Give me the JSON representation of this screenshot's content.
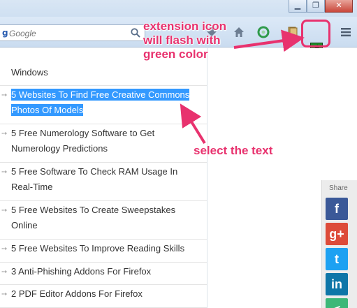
{
  "window": {
    "minimize_glyph": "▁",
    "restore_glyph": "❐",
    "close_glyph": "✕"
  },
  "toolbar": {
    "search_placeholder": "Google",
    "search_engine_icon": "google-icon",
    "icons": [
      "download-icon",
      "home-icon",
      "addon-icon",
      "bookmark-icon",
      "extension-icon",
      "menu-icon"
    ]
  },
  "articles": [
    {
      "title": "Windows",
      "lines": [
        "Windows"
      ],
      "selected": false
    },
    {
      "title": "5 Websites To Find Free Creative Commons Photos Of Models",
      "lines": [
        "5 Websites To Find Free Creative Commons",
        "Photos Of Models"
      ],
      "selected": true
    },
    {
      "title": "5 Free Numerology Software to Get Numerology Predictions",
      "lines": [
        "5 Free Numerology Software to Get",
        "Numerology Predictions"
      ],
      "selected": false
    },
    {
      "title": "5 Free Software To Check RAM Usage In Real-Time",
      "lines": [
        "5 Free Software To Check RAM Usage In",
        "Real-Time"
      ],
      "selected": false
    },
    {
      "title": "5 Free Websites To Create Sweepstakes Online",
      "lines": [
        "5 Free Websites To Create Sweepstakes",
        "Online"
      ],
      "selected": false
    },
    {
      "title": "5 Free Websites To Improve Reading Skills",
      "lines": [
        "5 Free Websites To Improve Reading Skills"
      ],
      "selected": false
    },
    {
      "title": "3 Anti-Phishing Addons For Firefox",
      "lines": [
        "3 Anti-Phishing Addons For Firefox"
      ],
      "selected": false
    },
    {
      "title": "2 PDF Editor Addons For Firefox",
      "lines": [
        "2 PDF Editor Addons For Firefox"
      ],
      "selected": false
    }
  ],
  "share": {
    "label": "Share",
    "buttons": [
      {
        "name": "facebook",
        "glyph": "f",
        "color": "#3b5998"
      },
      {
        "name": "google-plus",
        "glyph": "g+",
        "color": "#dd4b39"
      },
      {
        "name": "twitter",
        "glyph": "t",
        "color": "#1da1f2"
      },
      {
        "name": "linkedin",
        "glyph": "in",
        "color": "#0e76a8"
      },
      {
        "name": "share",
        "glyph": "<",
        "color": "#3cb878"
      }
    ]
  },
  "annotations": {
    "extension": [
      "extension icon",
      "will flash with",
      "green color"
    ],
    "select": "select the text",
    "color": "#e8326e"
  },
  "colors": {
    "selection": "#3399ff",
    "extension_green": "#1f8a2a"
  }
}
